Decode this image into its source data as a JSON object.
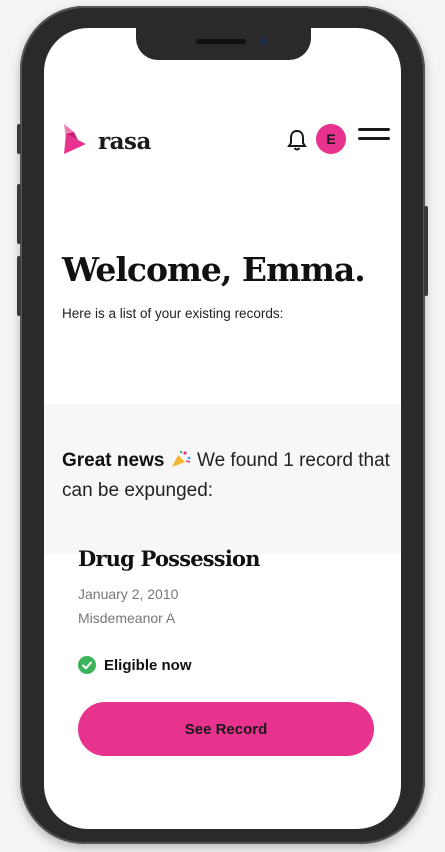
{
  "app": {
    "brand": "rasa",
    "accent": "#e8338e"
  },
  "header": {
    "logo_icon": "rasa-logo-mark",
    "notification_icon": "bell-icon",
    "avatar_initial": "E",
    "menu_icon": "hamburger-menu-icon"
  },
  "main": {
    "welcome": "Welcome, Emma.",
    "subtitle": "Here is a list of your existing records:",
    "news_bold": "Great news",
    "news_emoji_icon": "party-popper-icon",
    "news_text": "We found 1 record that can be expunged:"
  },
  "record": {
    "title": "Drug Possession",
    "date": "January 2, 2010",
    "classification": "Misdemeanor A",
    "status_icon": "check-circle-icon",
    "status": "Eligible now",
    "status_color": "#3cb35a",
    "button_label": "See Record"
  }
}
